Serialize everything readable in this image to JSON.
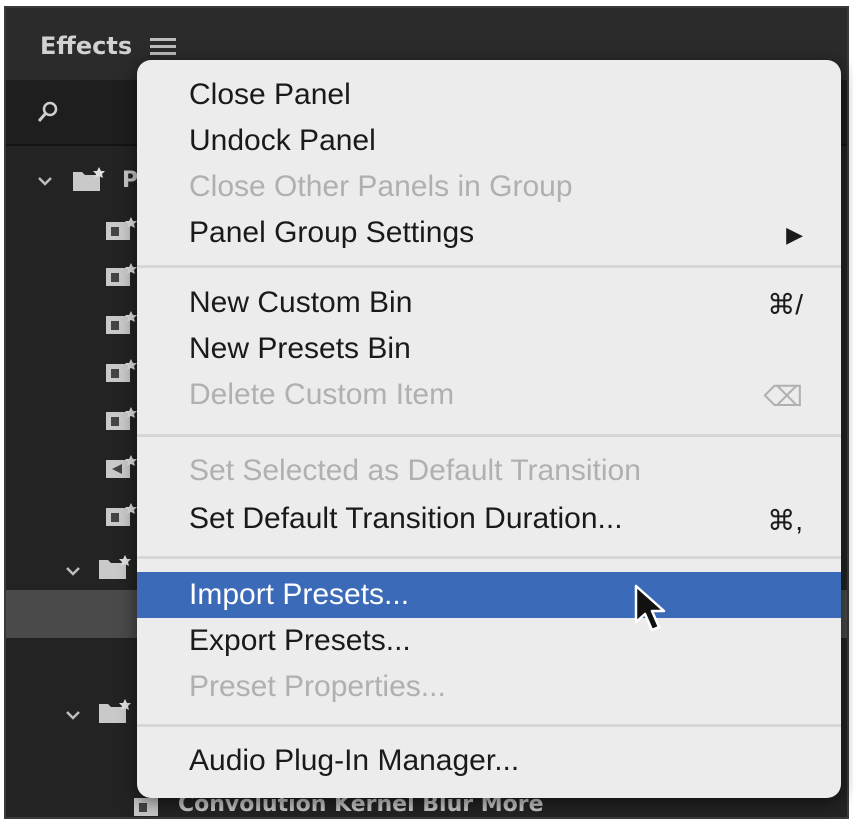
{
  "panel": {
    "title": "Effects"
  },
  "tree": {
    "items": [
      {
        "label": "P"
      },
      {
        "label": "Convolution Kernel Blur More"
      }
    ]
  },
  "menu": {
    "items": [
      {
        "label": "Close Panel",
        "shortcut": "",
        "disabled": false
      },
      {
        "label": "Undock Panel",
        "shortcut": "",
        "disabled": false
      },
      {
        "label": "Close Other Panels in Group",
        "shortcut": "",
        "disabled": true
      },
      {
        "label": "Panel Group Settings",
        "shortcut": "▶",
        "disabled": false
      },
      {
        "label": "New Custom Bin",
        "shortcut": "⌘/",
        "disabled": false
      },
      {
        "label": "New Presets Bin",
        "shortcut": "",
        "disabled": false
      },
      {
        "label": "Delete Custom Item",
        "shortcut": "⌫",
        "disabled": true
      },
      {
        "label": "Set Selected as Default Transition",
        "shortcut": "",
        "disabled": true
      },
      {
        "label": "Set Default Transition Duration...",
        "shortcut": "⌘,",
        "disabled": false
      },
      {
        "label": "Import Presets...",
        "shortcut": "",
        "disabled": false,
        "highlighted": true
      },
      {
        "label": "Export Presets...",
        "shortcut": "",
        "disabled": false
      },
      {
        "label": "Preset Properties...",
        "shortcut": "",
        "disabled": true
      },
      {
        "label": "Audio Plug-In Manager...",
        "shortcut": "",
        "disabled": false
      }
    ]
  },
  "colors": {
    "menu_bg": "#ececec",
    "highlight": "#3b6ab8",
    "disabled_text": "#b0b0b0",
    "panel_bg": "#232323"
  }
}
